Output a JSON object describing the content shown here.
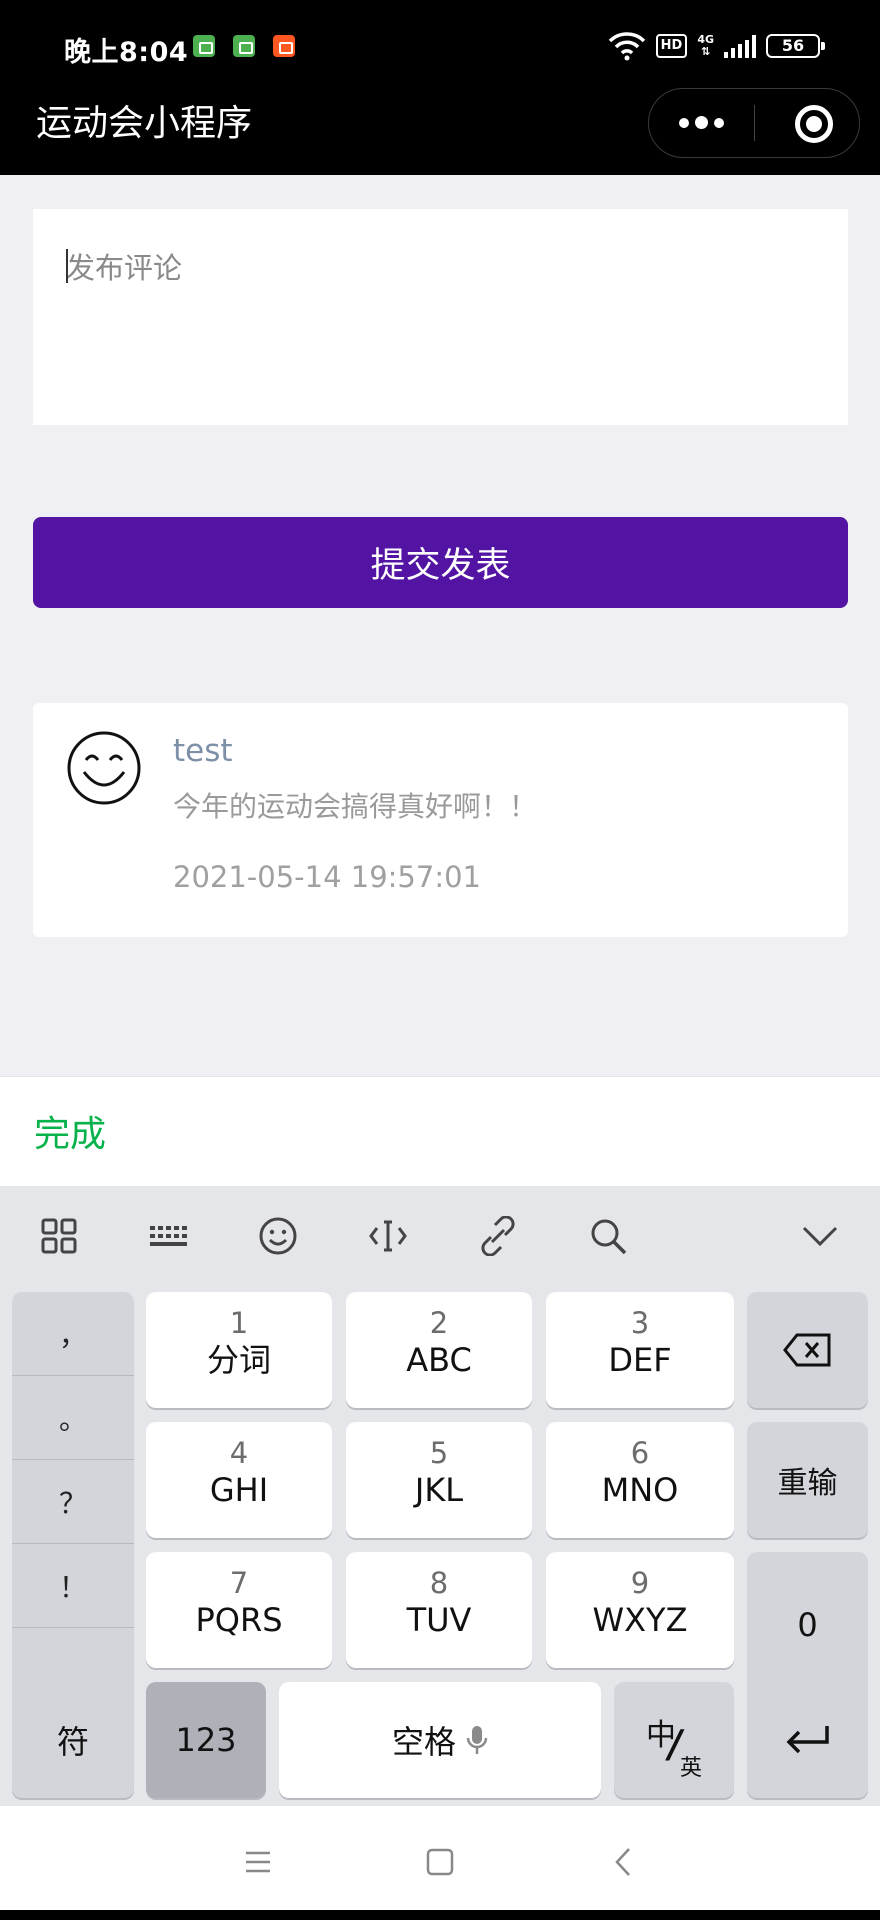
{
  "status_bar": {
    "time": "晚上8:04",
    "hd": "HD",
    "network": "4G",
    "battery": "56"
  },
  "nav": {
    "title": "运动会小程序"
  },
  "form": {
    "comment_placeholder": "发布评论",
    "submit_label": "提交发表"
  },
  "comments": [
    {
      "user": "test",
      "text": "今年的运动会搞得真好啊！！",
      "time": "2021-05-14 19:57:01"
    }
  ],
  "keyboard": {
    "done_label": "完成",
    "punctuation": [
      "，",
      "。",
      "？",
      "！"
    ],
    "keys": [
      {
        "num": "1",
        "letters": "分词"
      },
      {
        "num": "2",
        "letters": "ABC"
      },
      {
        "num": "3",
        "letters": "DEF"
      },
      {
        "num": "4",
        "letters": "GHI"
      },
      {
        "num": "5",
        "letters": "JKL"
      },
      {
        "num": "6",
        "letters": "MNO"
      },
      {
        "num": "7",
        "letters": "PQRS"
      },
      {
        "num": "8",
        "letters": "TUV"
      },
      {
        "num": "9",
        "letters": "WXYZ"
      }
    ],
    "retype_label": "重输",
    "zero_label": "0",
    "symbol_label": "符",
    "numeric_label": "123",
    "space_label": "空格",
    "lang_zh": "中",
    "lang_en": "英"
  },
  "colors": {
    "accent": "#5313a3",
    "done": "#07b24a"
  }
}
